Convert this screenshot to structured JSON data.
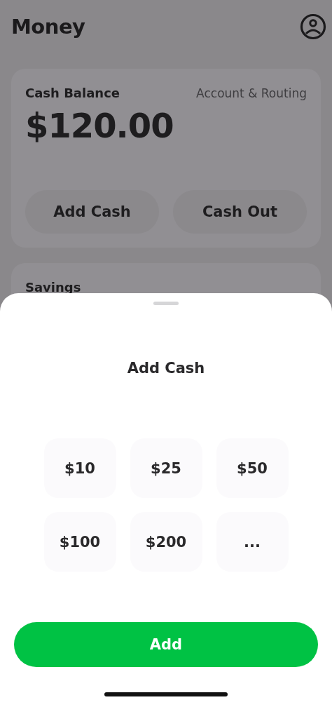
{
  "header": {
    "title": "Money"
  },
  "balance_card": {
    "label": "Cash Balance",
    "link": "Account & Routing",
    "amount": "$120.00",
    "buttons": [
      "Add Cash",
      "Cash Out"
    ]
  },
  "savings_card": {
    "label": "Savings"
  },
  "sheet": {
    "title": "Add Cash",
    "amounts": [
      "$10",
      "$25",
      "$50",
      "$100",
      "$200",
      "..."
    ],
    "primary_button": "Add"
  }
}
